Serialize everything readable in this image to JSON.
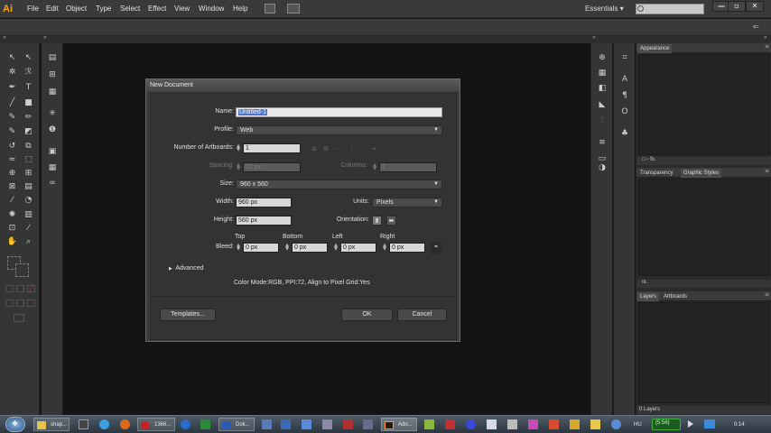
{
  "app": {
    "logo": "Ai",
    "menus": [
      "File",
      "Edit",
      "Object",
      "Type",
      "Select",
      "Effect",
      "View",
      "Window",
      "Help"
    ],
    "workspace": "Essentials",
    "workspace_caret": "▾",
    "window_buttons": [
      "—",
      "▫",
      "✕"
    ]
  },
  "panels": {
    "appearance_tab": "Appearance",
    "transparency_tab": "Transparency",
    "graphic_styles_tab": "Graphic Styles",
    "layers_tab": "Layers",
    "artboards_tab": "Artboards",
    "layers_count": "0 Layers"
  },
  "dialog": {
    "title": "New Document",
    "name_label": "Name:",
    "name_value": "Untitled-1",
    "profile_label": "Profile:",
    "profile_value": "Web",
    "artboards_label": "Number of Artboards:",
    "artboards_value": "1",
    "spacing_label": "Spacing:",
    "spacing_value": "20 px",
    "columns_label": "Columns:",
    "columns_value": "1",
    "size_label": "Size:",
    "size_value": "960 x 560",
    "width_label": "Width:",
    "width_value": "960 px",
    "units_label": "Units:",
    "units_value": "Pixels",
    "height_label": "Height:",
    "height_value": "560 px",
    "orientation_label": "Orientation:",
    "bleed_label": "Bleed:",
    "bleed_top_label": "Top",
    "bleed_bottom_label": "Bottom",
    "bleed_left_label": "Left",
    "bleed_right_label": "Right",
    "bleed_top": "0 px",
    "bleed_bottom": "0 px",
    "bleed_left": "0 px",
    "bleed_right": "0 px",
    "advanced_label": "Advanced",
    "summary": "Color Mode:RGB, PPI:72, Align to Pixel Grid:Yes",
    "templates_button": "Templates...",
    "ok_button": "OK",
    "cancel_button": "Cancel"
  },
  "taskbar": {
    "items": [
      "shap...",
      "1366...",
      "Dok...",
      "Ado..."
    ],
    "language": "HU",
    "battery": "(5:56)",
    "clock": "0:14"
  },
  "colors": {
    "accent_orange": "#f9a21a",
    "focus_border": "#d6951c",
    "selection": "#4f77c8",
    "battery_green": "#3fb13f"
  }
}
